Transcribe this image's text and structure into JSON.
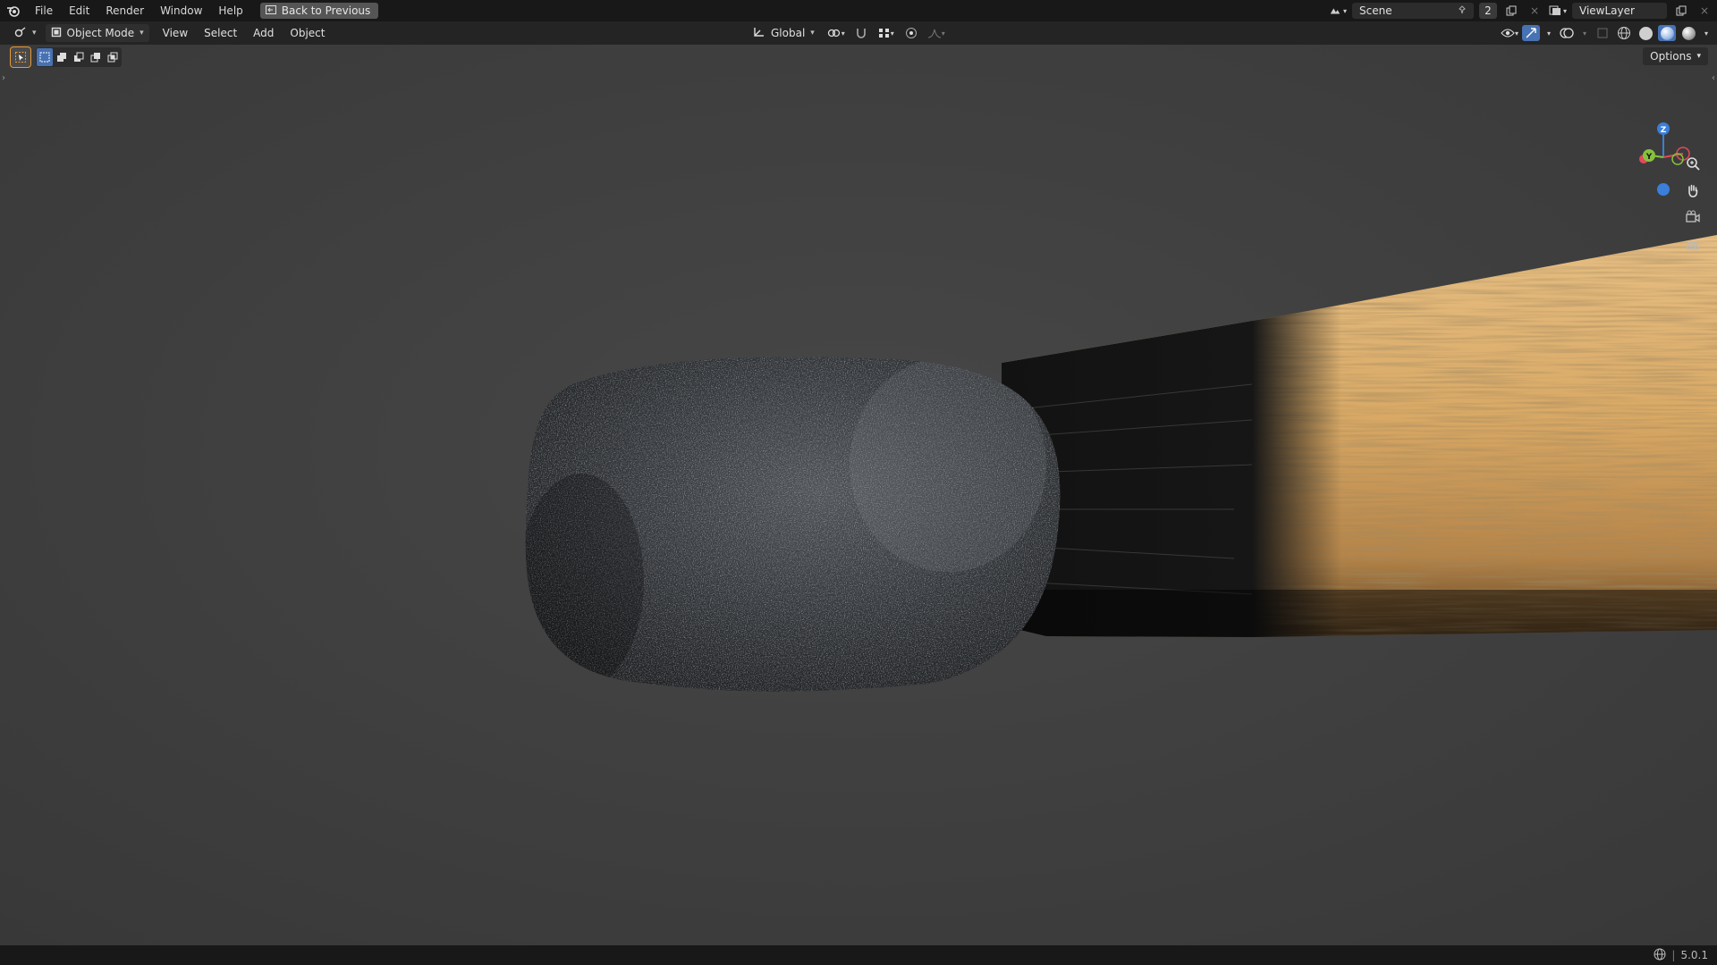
{
  "topbar": {
    "menu": [
      "File",
      "Edit",
      "Render",
      "Window",
      "Help"
    ],
    "back_button": "Back to Previous",
    "scene_name": "Scene",
    "scene_users": "2",
    "view_layer": "ViewLayer"
  },
  "header": {
    "mode": "Object Mode",
    "menu": [
      "View",
      "Select",
      "Add",
      "Object"
    ],
    "transform_orientation": "Global"
  },
  "viewport": {
    "options_label": "Options",
    "gizmo_axes": {
      "z": "Z",
      "y": "Y"
    }
  },
  "status": {
    "version": "5.0.1"
  },
  "colors": {
    "accent": "#4772b3",
    "active_tool": "#e89a36",
    "x_axis": "#e04a5a",
    "y_axis": "#86c23c",
    "z_axis": "#3a7fd9",
    "match_head": "#2f3236",
    "match_wood": "#d7a866",
    "charred_wood": "#141414"
  },
  "icons": [
    "blender-logo-icon",
    "back-arrow-icon",
    "scene-icon",
    "pin-icon",
    "copy-icon",
    "close-icon",
    "view-layer-icon",
    "editor-type-icon",
    "object-mode-icon",
    "transform-icon",
    "pivot-icon",
    "snap-icon",
    "proportional-icon",
    "visibility-icon",
    "gizmo-icon",
    "overlay-icon",
    "xray-icon",
    "wireframe-shading-icon",
    "solid-shading-icon",
    "material-shading-icon",
    "rendered-shading-icon",
    "select-tool-icon",
    "zoom-icon",
    "hand-pan-icon",
    "camera-icon",
    "grid-icon",
    "globe-icon"
  ]
}
